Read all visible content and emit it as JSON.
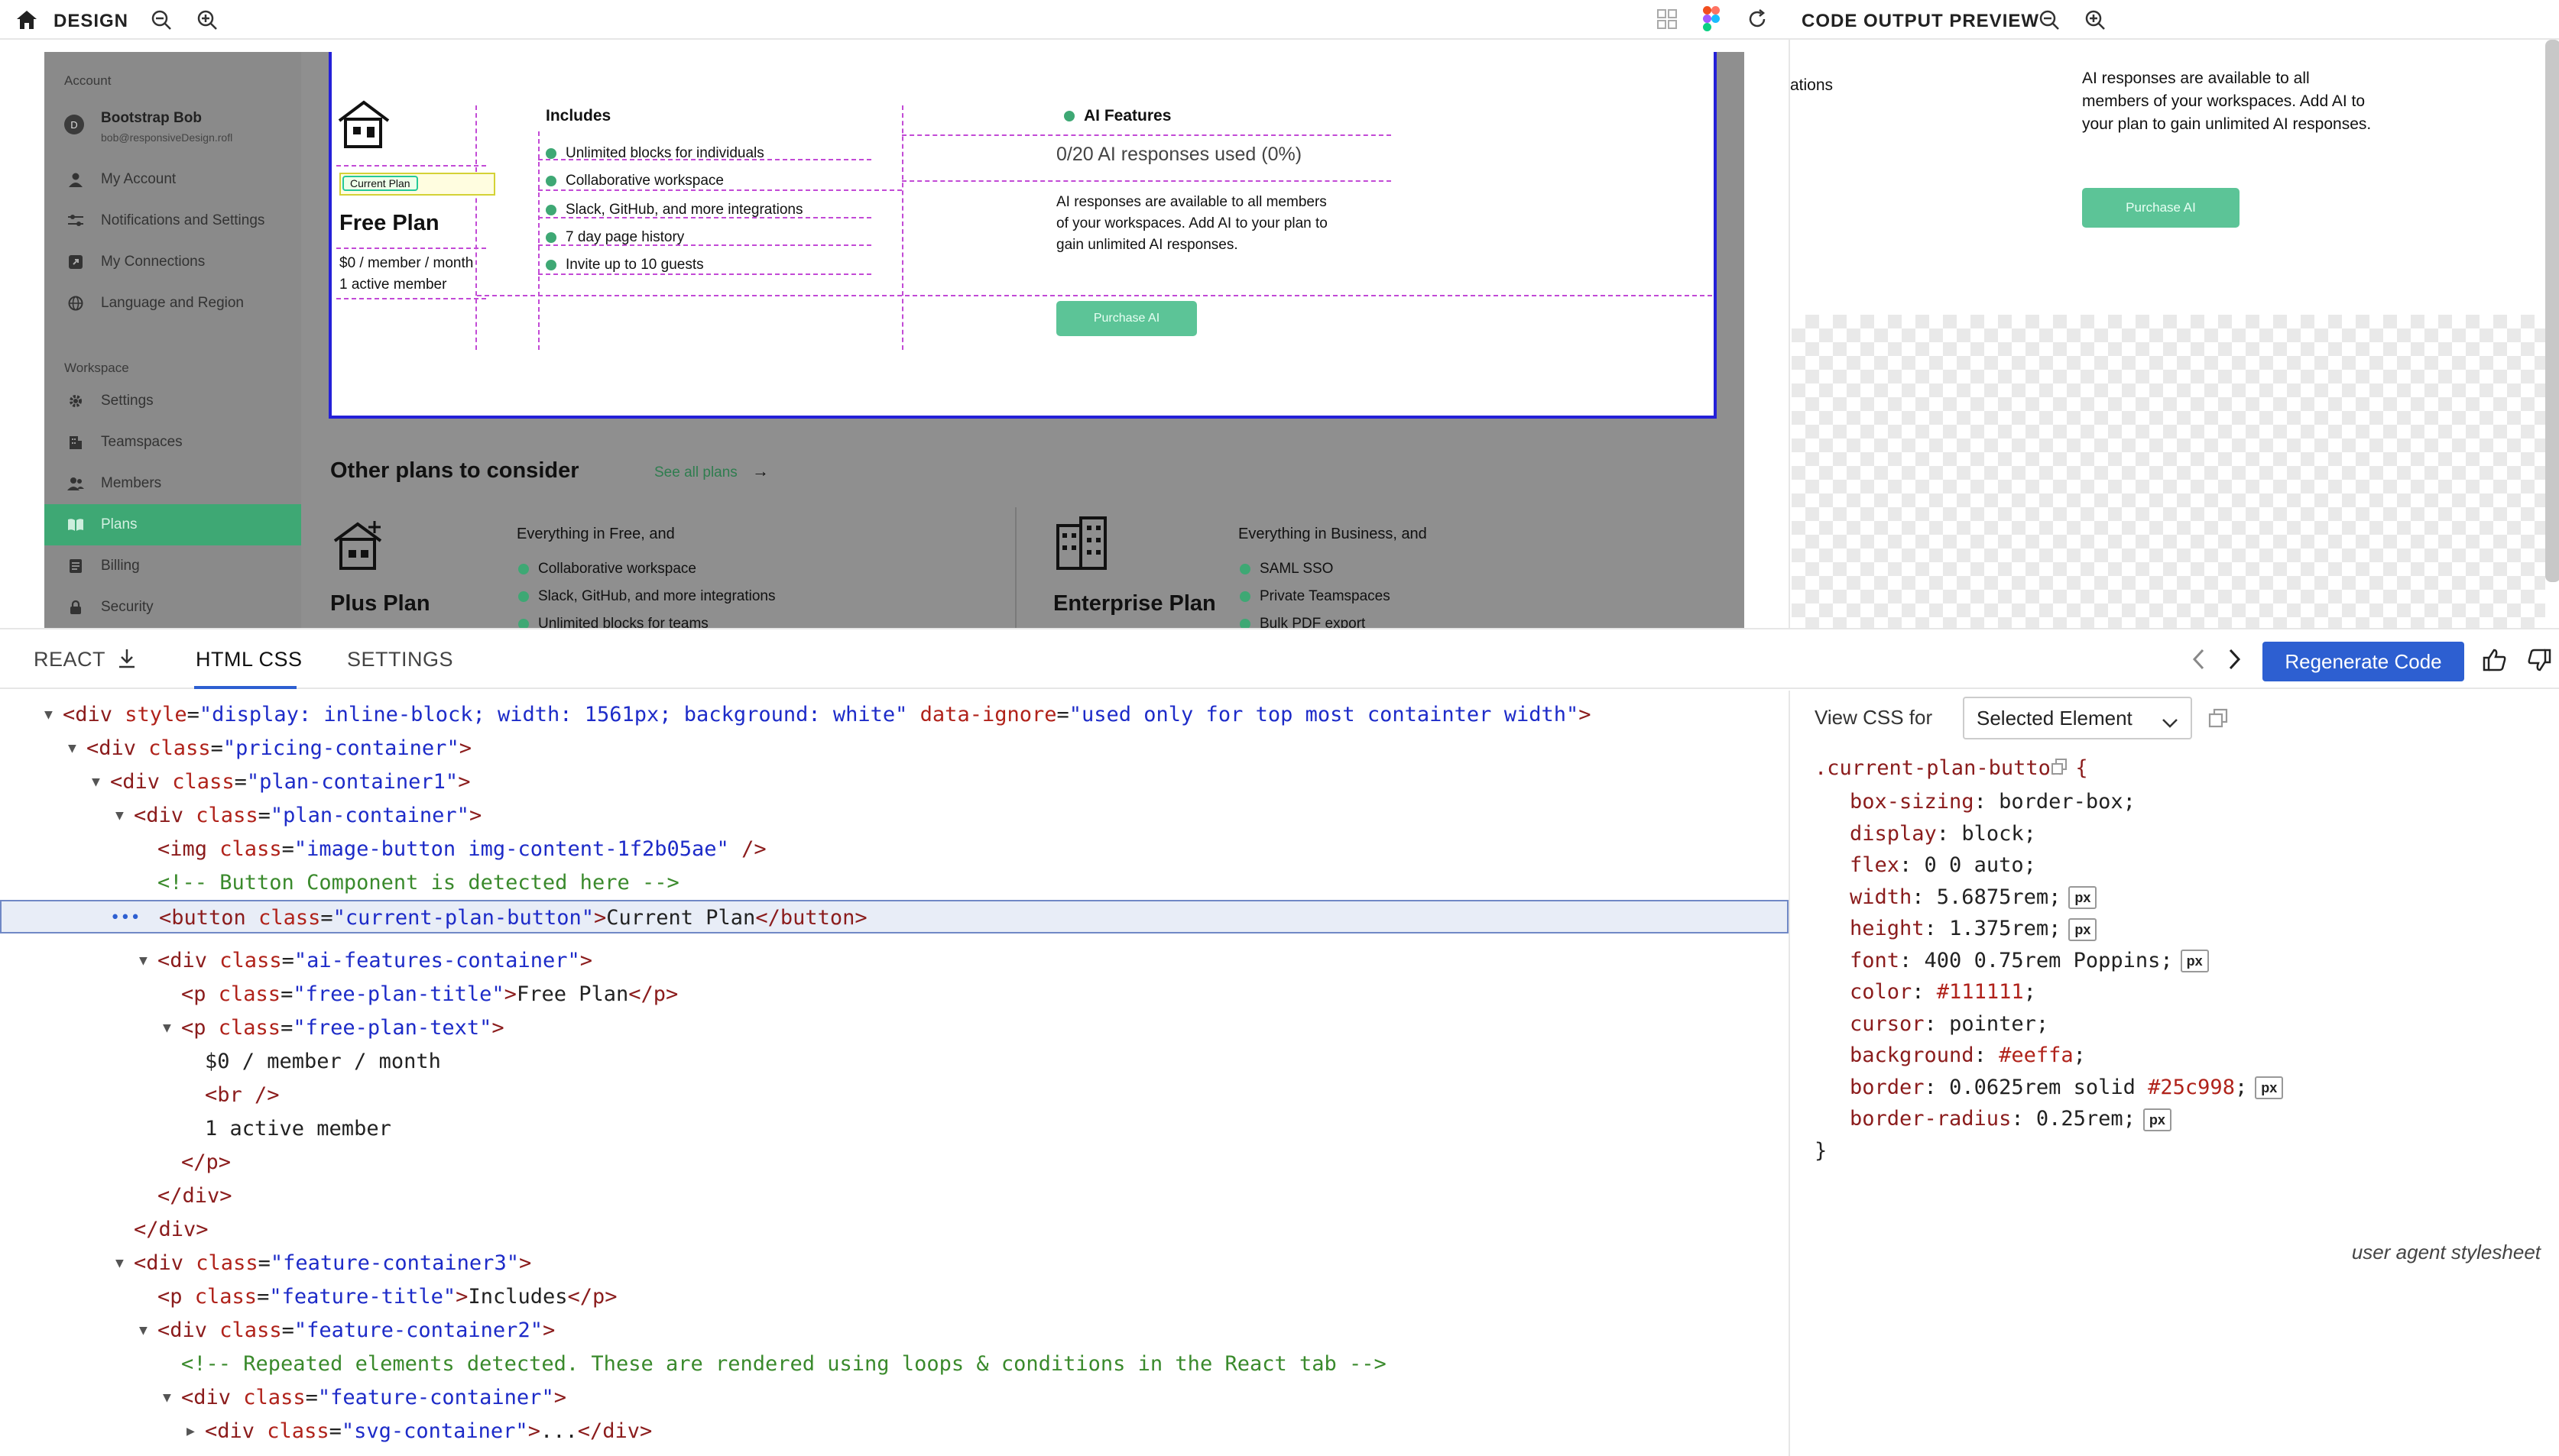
{
  "design_toolbar": {
    "title": "DESIGN"
  },
  "preview_toolbar": {
    "title": "CODE OUTPUT PREVIEW"
  },
  "sidebar": {
    "account_heading": "Account",
    "user_name": "Bootstrap Bob",
    "user_email": "bob@responsiveDesign.rofl",
    "avatar_initial": "D",
    "account_items": [
      "My Account",
      "Notifications and Settings",
      "My Connections",
      "Language and Region"
    ],
    "workspace_heading": "Workspace",
    "workspace_items": [
      "Settings",
      "Teamspaces",
      "Members",
      "Plans",
      "Billing",
      "Security"
    ]
  },
  "plan_card": {
    "current_plan_label": "Current Plan",
    "plan_title": "Free Plan",
    "price_line": "$0 / member / month",
    "members_line": "1 active member",
    "includes_title": "Includes",
    "includes": [
      "Unlimited blocks for individuals",
      "Collaborative workspace",
      "Slack, GitHub, and more integrations",
      "7 day page history",
      "Invite up to 10 guests"
    ],
    "ai_title": "AI Features",
    "ai_usage": "0/20 AI responses used (0%)",
    "ai_desc_1": "AI responses are available to all members",
    "ai_desc_2": "of your workspaces. Add AI to your plan to",
    "ai_desc_3": "gain unlimited AI responses.",
    "purchase_label": "Purchase AI"
  },
  "other_plans": {
    "title": "Other plans to consider",
    "see_all": "See all plans",
    "plus": {
      "name": "Plus Plan",
      "heading": "Everything in Free, and",
      "items": [
        "Collaborative workspace",
        "Slack, GitHub, and more integrations",
        "Unlimited blocks for teams"
      ]
    },
    "enterprise": {
      "name": "Enterprise Plan",
      "heading": "Everything in Business, and",
      "items": [
        "SAML SSO",
        "Private Teamspaces",
        "Bulk PDF export"
      ]
    }
  },
  "preview": {
    "cut_text": "ations",
    "desc_1": "AI responses are available to all",
    "desc_2": "members of your workspaces. Add AI to",
    "desc_3": "your plan to gain unlimited AI responses.",
    "purchase_label": "Purchase AI"
  },
  "bottom_tabs": {
    "react": "REACT",
    "html_css": "HTML CSS",
    "settings": "SETTINGS",
    "regenerate": "Regenerate Code"
  },
  "css_panel": {
    "view_label": "View CSS for",
    "select_value": "Selected Element",
    "selector": ".current-plan-button {",
    "props": [
      {
        "p": "box-sizing",
        "v": "border-box;"
      },
      {
        "p": "display",
        "v": "block;"
      },
      {
        "p": "flex",
        "v": "0 0 auto;"
      },
      {
        "p": "width",
        "v": "5.6875rem;",
        "px": "px"
      },
      {
        "p": "height",
        "v": "1.375rem;",
        "px": "px"
      },
      {
        "p": "font",
        "v": "400 0.75rem Poppins;",
        "px": "px"
      },
      {
        "p": "color",
        "v": "#111111;"
      },
      {
        "p": "cursor",
        "v": "pointer;"
      },
      {
        "p": "background",
        "v": "#eeffa;"
      },
      {
        "p": "border",
        "v": "0.0625rem solid #25c998;",
        "px": "px"
      },
      {
        "p": "border-radius",
        "v": "0.25rem;",
        "px": "px"
      }
    ],
    "close": "}",
    "ua_label": "user agent stylesheet"
  },
  "code_lines": [
    {
      "indent": 0,
      "tri": "▼",
      "html": "<span class='t-tag'>&lt;div</span> <span class='t-att'>style</span>=<span class='t-val'>\"display: inline-block; width: 1561px; background: white\"</span> <span class='t-att'>data-ignore</span>=<span class='t-val'>\"used only for top most containter width\"</span><span class='t-tag'>&gt;</span>"
    },
    {
      "indent": 1,
      "tri": "▼",
      "html": "<span class='t-tag'>&lt;div</span> <span class='t-att'>class</span>=<span class='t-val'>\"pricing-container\"</span><span class='t-tag'>&gt;</span>"
    },
    {
      "indent": 2,
      "tri": "▼",
      "html": "<span class='t-tag'>&lt;div</span> <span class='t-att'>class</span>=<span class='t-val'>\"plan-container1\"</span><span class='t-tag'>&gt;</span>"
    },
    {
      "indent": 3,
      "tri": "▼",
      "html": "<span class='t-tag'>&lt;div</span> <span class='t-att'>class</span>=<span class='t-val'>\"plan-container\"</span><span class='t-tag'>&gt;</span>"
    },
    {
      "indent": 4,
      "tri": "",
      "html": "<span class='t-tag'>&lt;img</span> <span class='t-att'>class</span>=<span class='t-val'>\"image-button img-content-1f2b05ae\"</span> <span class='t-tag'>/&gt;</span>"
    },
    {
      "indent": 4,
      "tri": "",
      "html": "<span class='t-com'>&lt;!-- Button Component is detected here --&gt;</span>"
    },
    {
      "indent": 4,
      "tri": "",
      "sel": true,
      "html": "<span class='t-tag'>&lt;button</span> <span class='t-att'>class</span>=<span class='t-val'>\"current-plan-button\"</span><span class='t-tag'>&gt;</span><span class='t-txt'>Current Plan</span><span class='t-tag'>&lt;/button&gt;</span>"
    },
    {
      "indent": 4,
      "tri": "▼",
      "html": "<span class='t-tag'>&lt;div</span> <span class='t-att'>class</span>=<span class='t-val'>\"ai-features-container\"</span><span class='t-tag'>&gt;</span>"
    },
    {
      "indent": 5,
      "tri": "",
      "html": "<span class='t-tag'>&lt;p</span> <span class='t-att'>class</span>=<span class='t-val'>\"free-plan-title\"</span><span class='t-tag'>&gt;</span><span class='t-txt'>Free Plan</span><span class='t-tag'>&lt;/p&gt;</span>"
    },
    {
      "indent": 5,
      "tri": "▼",
      "html": "<span class='t-tag'>&lt;p</span> <span class='t-att'>class</span>=<span class='t-val'>\"free-plan-text\"</span><span class='t-tag'>&gt;</span>"
    },
    {
      "indent": 6,
      "tri": "",
      "html": "<span class='t-txt'>$0 / member / month</span>"
    },
    {
      "indent": 6,
      "tri": "",
      "html": "<span class='t-tag'>&lt;br /&gt;</span>"
    },
    {
      "indent": 6,
      "tri": "",
      "html": "<span class='t-txt'>1 active member</span>"
    },
    {
      "indent": 5,
      "tri": "",
      "html": "<span class='t-tag'>&lt;/p&gt;</span>"
    },
    {
      "indent": 4,
      "tri": "",
      "html": "<span class='t-tag'>&lt;/div&gt;</span>"
    },
    {
      "indent": 3,
      "tri": "",
      "html": "<span class='t-tag'>&lt;/div&gt;</span>"
    },
    {
      "indent": 3,
      "tri": "▼",
      "html": "<span class='t-tag'>&lt;div</span> <span class='t-att'>class</span>=<span class='t-val'>\"feature-container3\"</span><span class='t-tag'>&gt;</span>"
    },
    {
      "indent": 4,
      "tri": "",
      "html": "<span class='t-tag'>&lt;p</span> <span class='t-att'>class</span>=<span class='t-val'>\"feature-title\"</span><span class='t-tag'>&gt;</span><span class='t-txt'>Includes</span><span class='t-tag'>&lt;/p&gt;</span>"
    },
    {
      "indent": 4,
      "tri": "▼",
      "html": "<span class='t-tag'>&lt;div</span> <span class='t-att'>class</span>=<span class='t-val'>\"feature-container2\"</span><span class='t-tag'>&gt;</span>"
    },
    {
      "indent": 5,
      "tri": "",
      "html": "<span class='t-com'>&lt;!-- Repeated elements detected. These are rendered using loops &amp; conditions in the React tab --&gt;</span>"
    },
    {
      "indent": 5,
      "tri": "▼",
      "html": "<span class='t-tag'>&lt;div</span> <span class='t-att'>class</span>=<span class='t-val'>\"feature-container\"</span><span class='t-tag'>&gt;</span>"
    },
    {
      "indent": 6,
      "tri": "▶",
      "html": "<span class='t-tag'>&lt;div</span> <span class='t-att'>class</span>=<span class='t-val'>\"svg-container\"</span><span class='t-tag'>&gt;</span><span class='t-txt'>...</span><span class='t-tag'>&lt;/div&gt;</span>"
    }
  ]
}
